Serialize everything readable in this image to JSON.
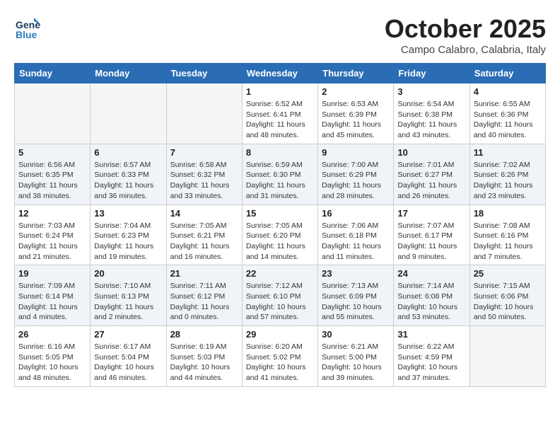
{
  "header": {
    "logo_line1": "General",
    "logo_line2": "Blue",
    "month": "October 2025",
    "location": "Campo Calabro, Calabria, Italy"
  },
  "weekdays": [
    "Sunday",
    "Monday",
    "Tuesday",
    "Wednesday",
    "Thursday",
    "Friday",
    "Saturday"
  ],
  "weeks": [
    [
      {
        "day": "",
        "info": ""
      },
      {
        "day": "",
        "info": ""
      },
      {
        "day": "",
        "info": ""
      },
      {
        "day": "1",
        "info": "Sunrise: 6:52 AM\nSunset: 6:41 PM\nDaylight: 11 hours\nand 48 minutes."
      },
      {
        "day": "2",
        "info": "Sunrise: 6:53 AM\nSunset: 6:39 PM\nDaylight: 11 hours\nand 45 minutes."
      },
      {
        "day": "3",
        "info": "Sunrise: 6:54 AM\nSunset: 6:38 PM\nDaylight: 11 hours\nand 43 minutes."
      },
      {
        "day": "4",
        "info": "Sunrise: 6:55 AM\nSunset: 6:36 PM\nDaylight: 11 hours\nand 40 minutes."
      }
    ],
    [
      {
        "day": "5",
        "info": "Sunrise: 6:56 AM\nSunset: 6:35 PM\nDaylight: 11 hours\nand 38 minutes."
      },
      {
        "day": "6",
        "info": "Sunrise: 6:57 AM\nSunset: 6:33 PM\nDaylight: 11 hours\nand 36 minutes."
      },
      {
        "day": "7",
        "info": "Sunrise: 6:58 AM\nSunset: 6:32 PM\nDaylight: 11 hours\nand 33 minutes."
      },
      {
        "day": "8",
        "info": "Sunrise: 6:59 AM\nSunset: 6:30 PM\nDaylight: 11 hours\nand 31 minutes."
      },
      {
        "day": "9",
        "info": "Sunrise: 7:00 AM\nSunset: 6:29 PM\nDaylight: 11 hours\nand 28 minutes."
      },
      {
        "day": "10",
        "info": "Sunrise: 7:01 AM\nSunset: 6:27 PM\nDaylight: 11 hours\nand 26 minutes."
      },
      {
        "day": "11",
        "info": "Sunrise: 7:02 AM\nSunset: 6:26 PM\nDaylight: 11 hours\nand 23 minutes."
      }
    ],
    [
      {
        "day": "12",
        "info": "Sunrise: 7:03 AM\nSunset: 6:24 PM\nDaylight: 11 hours\nand 21 minutes."
      },
      {
        "day": "13",
        "info": "Sunrise: 7:04 AM\nSunset: 6:23 PM\nDaylight: 11 hours\nand 19 minutes."
      },
      {
        "day": "14",
        "info": "Sunrise: 7:05 AM\nSunset: 6:21 PM\nDaylight: 11 hours\nand 16 minutes."
      },
      {
        "day": "15",
        "info": "Sunrise: 7:05 AM\nSunset: 6:20 PM\nDaylight: 11 hours\nand 14 minutes."
      },
      {
        "day": "16",
        "info": "Sunrise: 7:06 AM\nSunset: 6:18 PM\nDaylight: 11 hours\nand 11 minutes."
      },
      {
        "day": "17",
        "info": "Sunrise: 7:07 AM\nSunset: 6:17 PM\nDaylight: 11 hours\nand 9 minutes."
      },
      {
        "day": "18",
        "info": "Sunrise: 7:08 AM\nSunset: 6:16 PM\nDaylight: 11 hours\nand 7 minutes."
      }
    ],
    [
      {
        "day": "19",
        "info": "Sunrise: 7:09 AM\nSunset: 6:14 PM\nDaylight: 11 hours\nand 4 minutes."
      },
      {
        "day": "20",
        "info": "Sunrise: 7:10 AM\nSunset: 6:13 PM\nDaylight: 11 hours\nand 2 minutes."
      },
      {
        "day": "21",
        "info": "Sunrise: 7:11 AM\nSunset: 6:12 PM\nDaylight: 11 hours\nand 0 minutes."
      },
      {
        "day": "22",
        "info": "Sunrise: 7:12 AM\nSunset: 6:10 PM\nDaylight: 10 hours\nand 57 minutes."
      },
      {
        "day": "23",
        "info": "Sunrise: 7:13 AM\nSunset: 6:09 PM\nDaylight: 10 hours\nand 55 minutes."
      },
      {
        "day": "24",
        "info": "Sunrise: 7:14 AM\nSunset: 6:08 PM\nDaylight: 10 hours\nand 53 minutes."
      },
      {
        "day": "25",
        "info": "Sunrise: 7:15 AM\nSunset: 6:06 PM\nDaylight: 10 hours\nand 50 minutes."
      }
    ],
    [
      {
        "day": "26",
        "info": "Sunrise: 6:16 AM\nSunset: 5:05 PM\nDaylight: 10 hours\nand 48 minutes."
      },
      {
        "day": "27",
        "info": "Sunrise: 6:17 AM\nSunset: 5:04 PM\nDaylight: 10 hours\nand 46 minutes."
      },
      {
        "day": "28",
        "info": "Sunrise: 6:19 AM\nSunset: 5:03 PM\nDaylight: 10 hours\nand 44 minutes."
      },
      {
        "day": "29",
        "info": "Sunrise: 6:20 AM\nSunset: 5:02 PM\nDaylight: 10 hours\nand 41 minutes."
      },
      {
        "day": "30",
        "info": "Sunrise: 6:21 AM\nSunset: 5:00 PM\nDaylight: 10 hours\nand 39 minutes."
      },
      {
        "day": "31",
        "info": "Sunrise: 6:22 AM\nSunset: 4:59 PM\nDaylight: 10 hours\nand 37 minutes."
      },
      {
        "day": "",
        "info": ""
      }
    ]
  ]
}
